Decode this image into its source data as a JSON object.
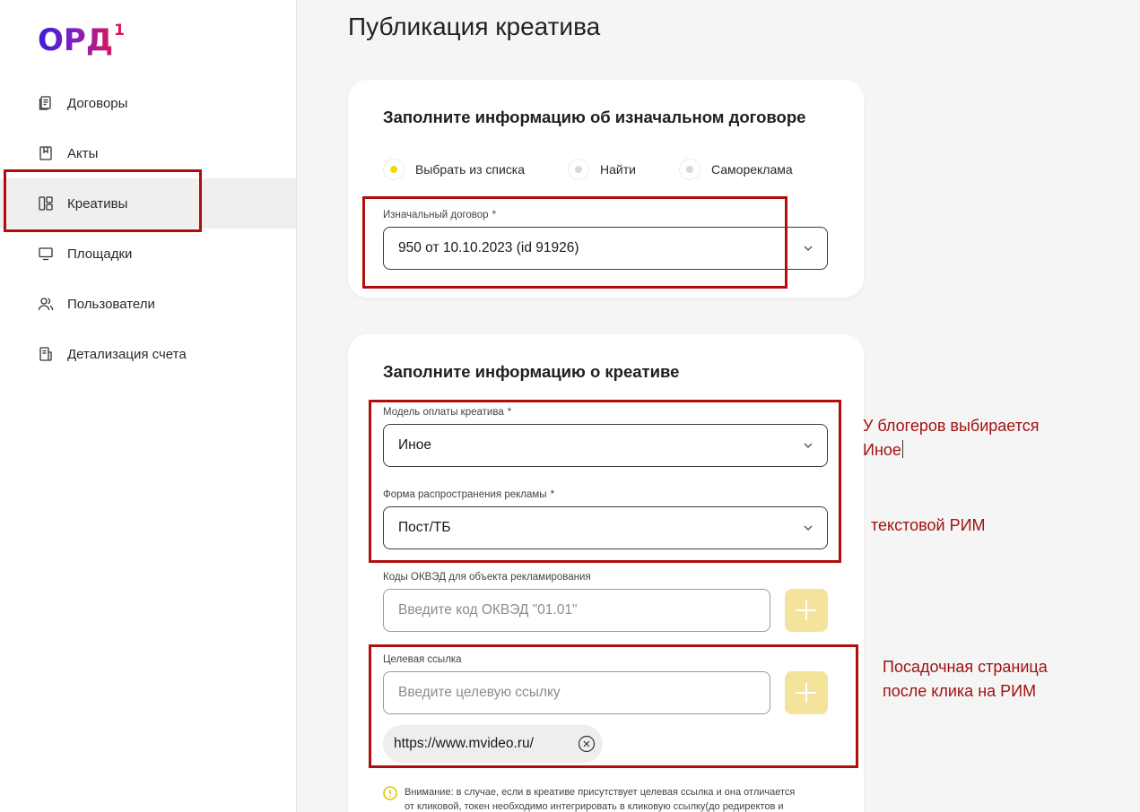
{
  "app": {
    "logo_text": "ОРД",
    "logo_sup": "1"
  },
  "sidebar": {
    "items": [
      {
        "label": "Договоры",
        "icon": "contract-icon"
      },
      {
        "label": "Акты",
        "icon": "act-icon"
      },
      {
        "label": "Креативы",
        "icon": "creatives-icon",
        "active": true
      },
      {
        "label": "Площадки",
        "icon": "monitor-icon"
      },
      {
        "label": "Пользователи",
        "icon": "users-icon"
      },
      {
        "label": "Детализация счета",
        "icon": "invoice-icon"
      }
    ]
  },
  "page": {
    "title": "Публикация креатива"
  },
  "contract_card": {
    "title": "Заполните информацию об изначальном договоре",
    "radios": [
      {
        "label": "Выбрать из списка",
        "selected": true
      },
      {
        "label": "Найти",
        "selected": false
      },
      {
        "label": "Самореклама",
        "selected": false
      }
    ],
    "contract_label": "Изначальный договор",
    "required_mark": "*",
    "contract_value": "950 от 10.10.2023 (id 91926)"
  },
  "creative_card": {
    "title": "Заполните информацию о креативе",
    "payment_label": "Модель оплаты креатива",
    "payment_value": "Иное",
    "form_label": "Форма распространения рекламы",
    "form_value": "Пост/ТБ",
    "okved_label": "Коды ОКВЭД для объекта рекламирования",
    "okved_placeholder": "Введите код ОКВЭД \"01.01\"",
    "link_label": "Целевая ссылка",
    "link_placeholder": "Введите целевую ссылку",
    "link_chip": "https://www.mvideo.ru/",
    "warning_line1": "Внимание: в случае, если в креативе присутствует целевая ссылка и она отличается",
    "warning_line2": "от кликовой, токен необходимо интегрировать в кликовую ссылку(до редиректов и"
  },
  "annotations": {
    "blogger_line1": "У блогеров выбирается",
    "blogger_line2": "Иное",
    "text_rim": "текстовой РИМ",
    "landing_line1": "Посадочная страница",
    "landing_line2": "после клика на РИМ"
  },
  "colors": {
    "accent_yellow": "#f6d800",
    "plus_button": "#f3e39b",
    "annotation_red": "#b00e0e"
  }
}
